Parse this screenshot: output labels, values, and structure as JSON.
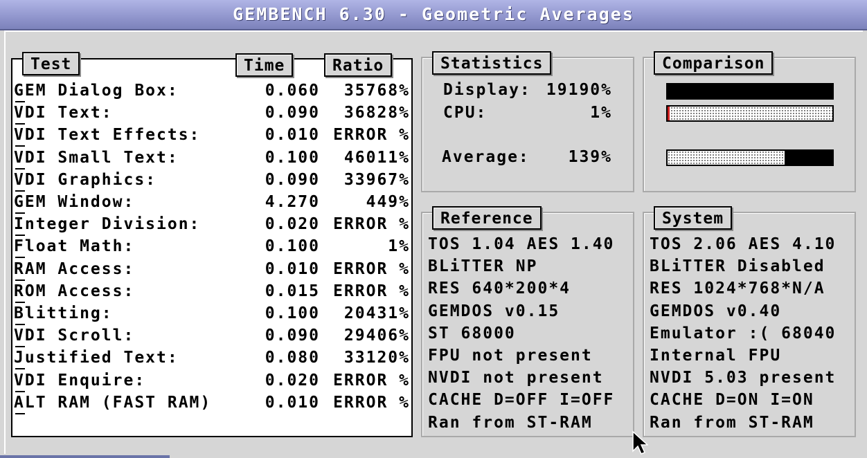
{
  "window": {
    "title": "GEMBENCH 6.30 - Geometric Averages"
  },
  "tests": {
    "headers": {
      "test": "Test",
      "time": "Time",
      "ratio": "Ratio"
    },
    "rows": [
      {
        "name": "GEM Dialog Box:",
        "time": "0.060",
        "ratio": "35768%"
      },
      {
        "name": "VDI Text:",
        "time": "0.090",
        "ratio": "36828%"
      },
      {
        "name": "VDI Text Effects:",
        "time": "0.010",
        "ratio": "ERROR %"
      },
      {
        "name": "VDI Small Text:",
        "time": "0.100",
        "ratio": "46011%"
      },
      {
        "name": "VDI Graphics:",
        "time": "0.090",
        "ratio": "33967%"
      },
      {
        "name": "GEM Window:",
        "time": "4.270",
        "ratio": "449%"
      },
      {
        "name": "Integer Division:",
        "time": "0.020",
        "ratio": "ERROR %"
      },
      {
        "name": "Float Math:",
        "time": "0.100",
        "ratio": "1%"
      },
      {
        "name": "RAM Access:",
        "time": "0.010",
        "ratio": "ERROR %"
      },
      {
        "name": "ROM Access:",
        "time": "0.015",
        "ratio": "ERROR %"
      },
      {
        "name": "Blitting:",
        "time": "0.100",
        "ratio": "20431%"
      },
      {
        "name": "VDI Scroll:",
        "time": "0.090",
        "ratio": "29406%"
      },
      {
        "name": "Justified Text:",
        "time": "0.080",
        "ratio": "33120%"
      },
      {
        "name": "VDI Enquire:",
        "time": "0.020",
        "ratio": "ERROR %"
      },
      {
        "name": "ALT RAM (FAST RAM)",
        "time": "0.010",
        "ratio": "ERROR %"
      }
    ]
  },
  "statistics": {
    "title": "Statistics",
    "display_label": "Display:",
    "display_value": "19190%",
    "cpu_label": "CPU:",
    "cpu_value": "1%",
    "average_label": "Average:",
    "average_value": "139%"
  },
  "comparison": {
    "title": "Comparison",
    "display_fill": 1.0,
    "cpu_fill": 0.01,
    "average_fill": 0.29,
    "colors": {
      "bar": "#000000",
      "cpu_marker": "#d02020"
    }
  },
  "reference": {
    "title": "Reference",
    "lines": [
      "TOS 1.04  AES 1.40",
      "BLiTTER NP",
      "RES 640*200*4",
      "GEMDOS v0.15",
      "ST 68000",
      "FPU not present",
      "NVDI not present",
      "CACHE D=OFF  I=OFF",
      "Ran from ST-RAM"
    ]
  },
  "system": {
    "title": "System",
    "lines": [
      "TOS 2.06  AES 4.10",
      "BLiTTER Disabled",
      "RES 1024*768*N/A",
      "GEMDOS v0.40",
      "Emulator :( 68040",
      "Internal FPU",
      "NVDI 5.03 present",
      "CACHE D=ON   I=ON",
      "Ran from ST-RAM"
    ]
  },
  "icons": {
    "cursor": "arrow-pointer-icon"
  }
}
